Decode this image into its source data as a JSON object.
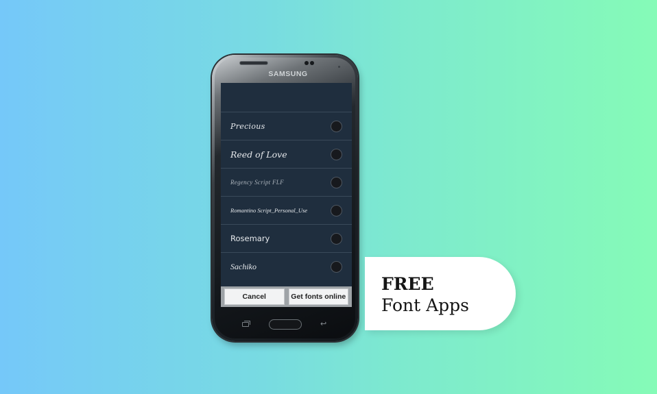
{
  "colors": {
    "background_left": "#75c8f9",
    "background_right": "#85fbb7",
    "screen_bg": "#1f2e3e",
    "button_bar": "#9ea3a7",
    "tag_bg": "#ffffff"
  },
  "phone": {
    "brand": "SAMSUNG",
    "icons": {
      "recent_apps": "recent-apps-icon",
      "home": "home-button",
      "back": "back-icon"
    },
    "back_glyph": "↩"
  },
  "font_list": {
    "items": [
      {
        "label": "Precious",
        "selected": false
      },
      {
        "label": "Reed of Love",
        "selected": false
      },
      {
        "label": "Regency Script FLF",
        "selected": false
      },
      {
        "label": "Romantino Script_Personal_Use",
        "selected": false
      },
      {
        "label": "Rosemary",
        "selected": false
      },
      {
        "label": "Sachiko",
        "selected": false
      }
    ]
  },
  "dialog_buttons": {
    "cancel": "Cancel",
    "get_fonts": "Get fonts online"
  },
  "tag": {
    "line1": "FREE",
    "line2": "Font Apps"
  }
}
